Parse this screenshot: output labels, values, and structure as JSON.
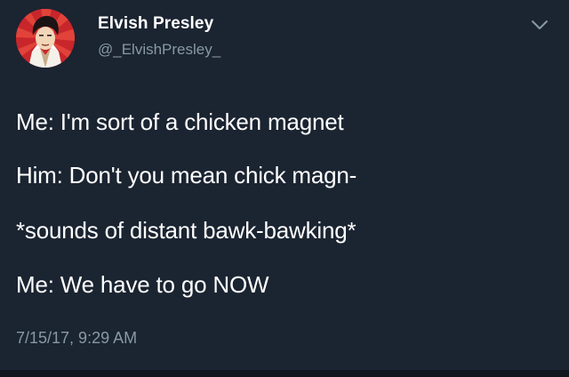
{
  "tweet": {
    "author": {
      "display_name": "Elvish Presley",
      "handle": "@_ElvishPresley_"
    },
    "lines": [
      "Me: I'm sort of a chicken magnet",
      "Him: Don't you mean chick magn-",
      "*sounds of distant bawk-bawking*",
      "Me: We have to go NOW"
    ],
    "timestamp": "7/15/17, 9:29 AM"
  },
  "icons": {
    "avatar": "elvis-portrait-avatar",
    "menu": "chevron-down-icon"
  },
  "colors": {
    "background": "#1b2431",
    "text": "#ffffff",
    "secondary_text": "#8899a6",
    "avatar_red": "#c8262b"
  }
}
